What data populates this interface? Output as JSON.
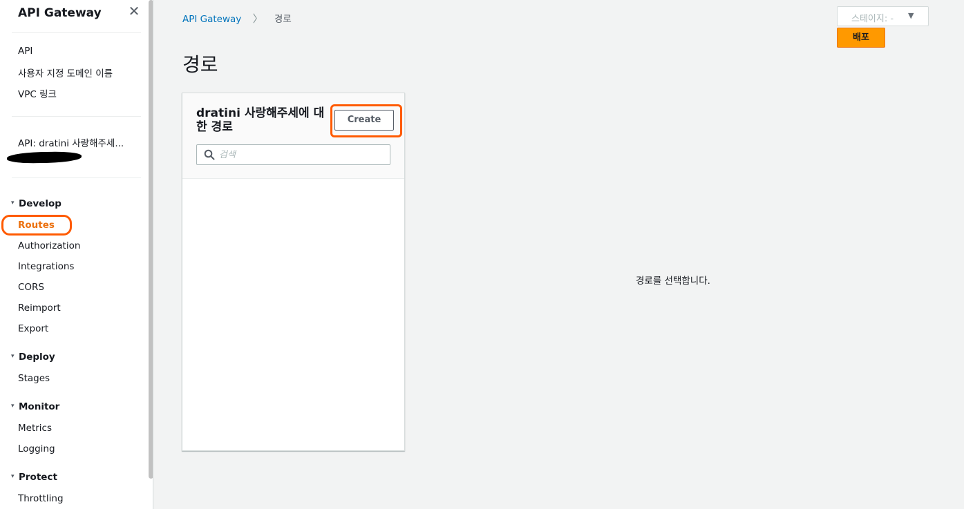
{
  "sidebar": {
    "title": "API Gateway",
    "close_icon": "close-icon",
    "top_links": [
      "API",
      "사용자 지정 도메인 이름",
      "VPC 링크"
    ],
    "api_label": "API: dratini 사랑해주세...",
    "sections": [
      {
        "label": "Develop",
        "items": [
          "Routes",
          "Authorization",
          "Integrations",
          "CORS",
          "Reimport",
          "Export"
        ]
      },
      {
        "label": "Deploy",
        "items": [
          "Stages"
        ]
      },
      {
        "label": "Monitor",
        "items": [
          "Metrics",
          "Logging"
        ]
      },
      {
        "label": "Protect",
        "items": [
          "Throttling"
        ]
      }
    ],
    "active_item": "Routes"
  },
  "breadcrumb": {
    "root": "API Gateway",
    "current": "경로"
  },
  "stage": {
    "label": "스테이지: -"
  },
  "deploy": {
    "label": "배포"
  },
  "page": {
    "title": "경로"
  },
  "panel": {
    "title": "dratini 사랑해주세에 대한 경로",
    "create_label": "Create",
    "search_placeholder": "검색"
  },
  "detail": {
    "empty_message": "경로를 선택합니다."
  },
  "colors": {
    "accent": "#ec7211",
    "link": "#0073bb",
    "deploy": "#ff9900",
    "annotation": "#ff5a00"
  }
}
